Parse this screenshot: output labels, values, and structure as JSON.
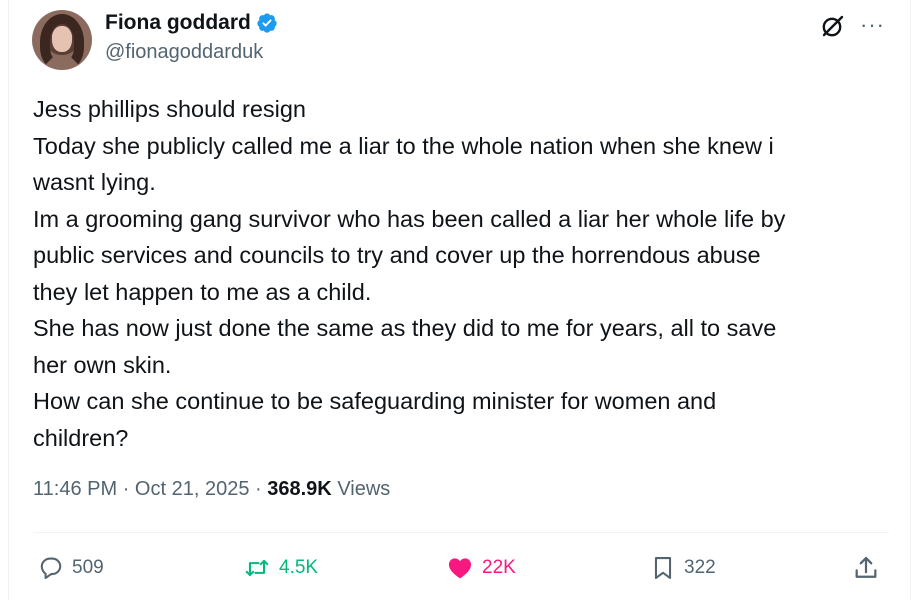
{
  "colors": {
    "verified": "#1d9bf0",
    "retweet_active": "#00ba7c",
    "like_active": "#f91880",
    "secondary_text": "#536471"
  },
  "author": {
    "display_name": "Fiona goddard",
    "handle": "@fionagoddarduk",
    "verified": true
  },
  "header_icons": [
    "grok-icon",
    "more-icon"
  ],
  "more_label": "···",
  "tweet": {
    "lines": [
      "Jess phillips should resign",
      "Today she publicly called me a liar to the whole nation when she knew i",
      "wasnt lying.",
      "Im a grooming gang survivor who has been called a liar her whole life by",
      "public services and councils to try and cover up the horrendous abuse",
      "they let happen to me as a child.",
      "She has now just done the same as they did to me for years, all to save",
      "her own skin.",
      "How can she continue to be safeguarding minister for women and",
      "children?"
    ]
  },
  "meta": {
    "time": "11:46 PM",
    "separator": "·",
    "date": "Oct 21, 2025",
    "views_count": "368.9K",
    "views_label": "Views"
  },
  "actions": {
    "replies": "509",
    "retweets": "4.5K",
    "likes": "22K",
    "bookmarks": "322"
  }
}
